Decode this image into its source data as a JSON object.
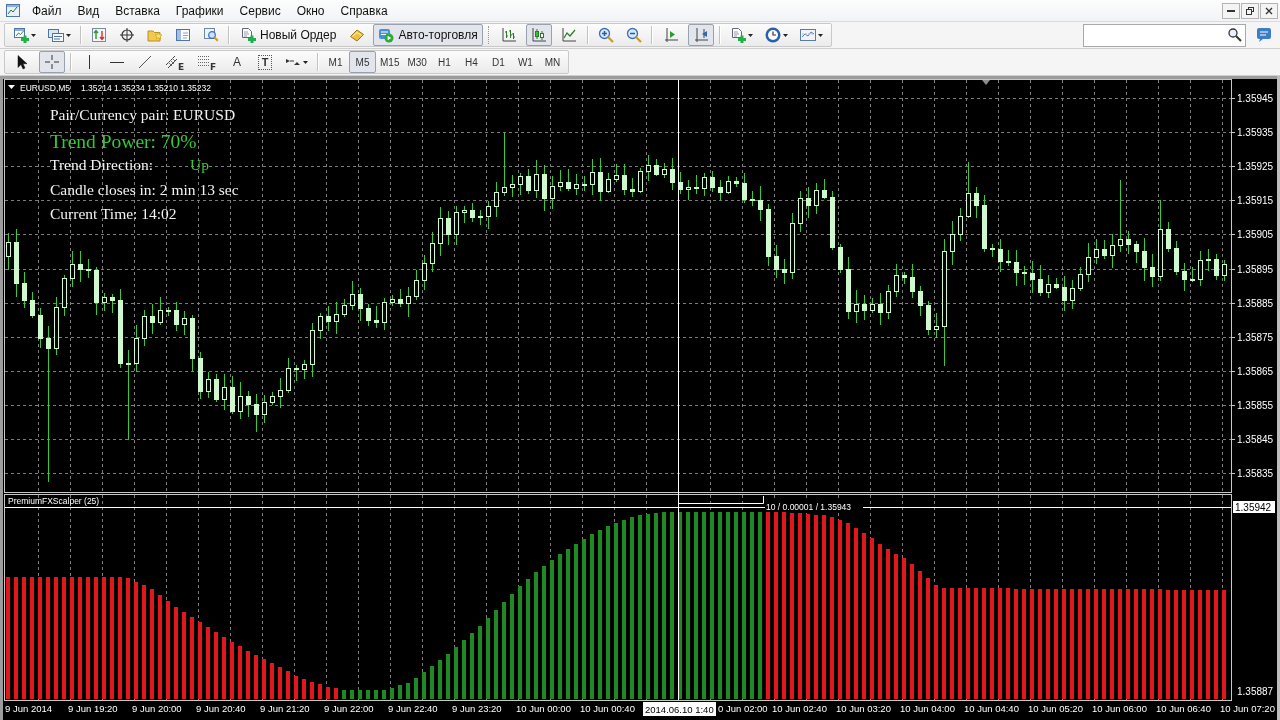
{
  "menu_bar": {
    "items": [
      "Файл",
      "Вид",
      "Вставка",
      "Графики",
      "Сервис",
      "Окно",
      "Справка"
    ]
  },
  "toolbar": {
    "order_button": "Новый Ордер",
    "autotrading_button": {
      "label": "Авто-торговля",
      "on": true
    },
    "chart_types": [
      {
        "selected": false
      },
      {
        "selected": true
      },
      {
        "selected": false
      }
    ],
    "scroll_modes": [
      {
        "selected": false
      },
      {
        "selected": true
      }
    ]
  },
  "tools_bar": {
    "pointer_tools": [
      {
        "selected": false
      },
      {
        "selected": true
      }
    ],
    "channel_mark": "E",
    "fibonacci_mark": "F",
    "text_tool": "A",
    "label_tool": "T",
    "periods": [
      {
        "label": "M1",
        "selected": false
      },
      {
        "label": "M5",
        "selected": true
      },
      {
        "label": "M15",
        "selected": false
      },
      {
        "label": "M30",
        "selected": false
      },
      {
        "label": "H1",
        "selected": false
      },
      {
        "label": "H4",
        "selected": false
      },
      {
        "label": "D1",
        "selected": false
      },
      {
        "label": "W1",
        "selected": false
      },
      {
        "label": "MN",
        "selected": false
      }
    ]
  },
  "chart": {
    "symbol": "EURUSD,M5",
    "quotes": "1.35214 1.35234 1.35210 1.35232",
    "info": {
      "pair": "Pair/Currency pair: EURUSD",
      "trend_power": "Trend Power: 70%",
      "trend_direction_label": "Trend Direction:",
      "trend_direction_value": "Up",
      "candle_timer": "Candle closes in: 2 min 13 sec",
      "current_time": "Current Time: 14:02"
    },
    "price_axis": [
      "1.35945",
      "1.35935",
      "1.35925",
      "1.35915",
      "1.35905",
      "1.35895",
      "1.35885",
      "1.35875",
      "1.35865",
      "1.35855",
      "1.35845",
      "1.35835"
    ],
    "indicator": {
      "title": "PremiumFXScalper (25)",
      "readout": "10 / 0.00001 / 1.35943",
      "crosshair_price": "1.35942",
      "axis_label": "1.35887"
    },
    "time_axis": {
      "before": [
        "9 Jun 2014",
        "9 Jun 19:20",
        "9 Jun 20:00",
        "9 Jun 20:40",
        "9 Jun 21:20",
        "9 Jun 22:00",
        "9 Jun 22:40",
        "9 Jun 23:20",
        "10 Jun 00:00",
        "10 Jun 00:40"
      ],
      "crosshair_time": "2014.06.10 1:40",
      "after": [
        "0 Jun 02:00",
        "10 Jun 02:40",
        "10 Jun 03:20",
        "10 Jun 04:00",
        "10 Jun 04:40",
        "10 Jun 05:20",
        "10 Jun 06:00",
        "10 Jun 06:40",
        "10 Jun 07:20"
      ]
    }
  }
}
